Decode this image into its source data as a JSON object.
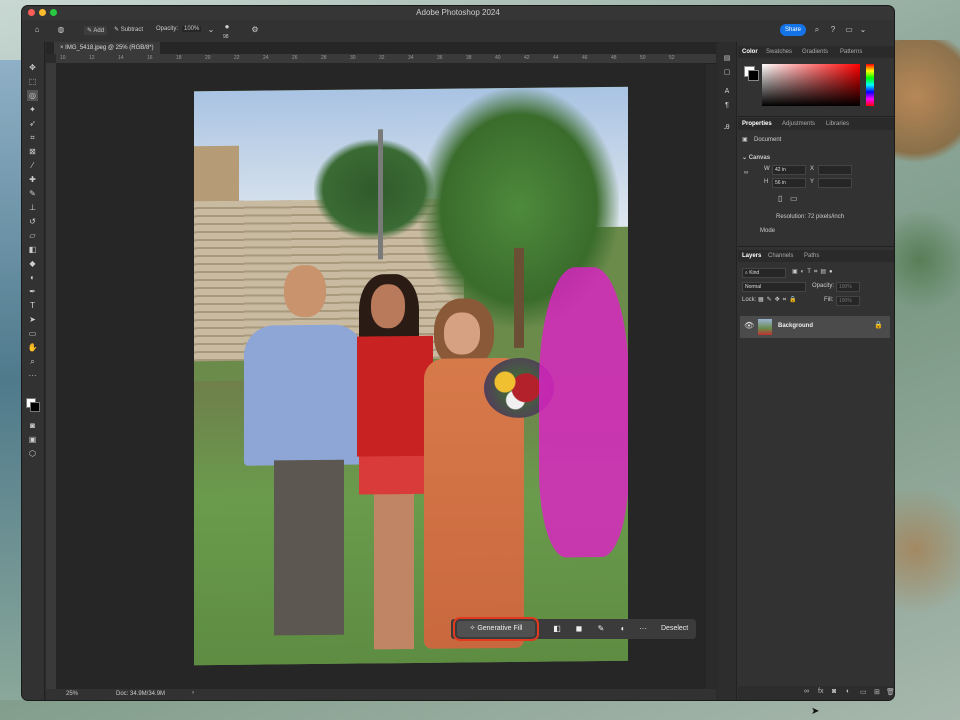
{
  "app": {
    "title": "Adobe Photoshop 2024",
    "share_label": "Share"
  },
  "options_bar": {
    "add_label": "Add",
    "subtract_label": "Subtract",
    "opacity_label": "Opacity:",
    "opacity_value": "100%",
    "brush_size": "98"
  },
  "document": {
    "tab_label": "IMG_5418.jpeg @ 25% (RGB/8*)"
  },
  "ruler": {
    "ticks": [
      "10",
      "12",
      "14",
      "16",
      "18",
      "20",
      "22",
      "24",
      "26",
      "28",
      "30",
      "32",
      "34",
      "36",
      "38",
      "40",
      "42",
      "44",
      "46",
      "48",
      "50",
      "52"
    ]
  },
  "context_bar": {
    "generative_fill": "Generative Fill",
    "deselect": "Deselect",
    "more": "···"
  },
  "status": {
    "zoom": "25%",
    "doc_size": "Doc: 34.9M/34.9M"
  },
  "color_panel": {
    "tabs": [
      "Color",
      "Swatches",
      "Gradients",
      "Patterns"
    ]
  },
  "properties_panel": {
    "tabs": [
      "Properties",
      "Adjustments",
      "Libraries"
    ],
    "document_label": "Document",
    "canvas_label": "Canvas",
    "w_label": "W",
    "w_value": "42 in",
    "h_label": "H",
    "h_value": "56 in",
    "x_label": "X",
    "y_label": "Y",
    "resolution": "Resolution: 72 pixels/inch",
    "mode_label": "Mode"
  },
  "layers_panel": {
    "tabs": [
      "Layers",
      "Channels",
      "Paths"
    ],
    "kind_label": "Kind",
    "blend_mode": "Normal",
    "opacity_label": "Opacity:",
    "opacity_value": "100%",
    "lock_label": "Lock:",
    "fill_label": "Fill:",
    "fill_value": "100%",
    "layer_name": "Background"
  },
  "colors": {
    "accent": "#1473e6",
    "highlight_box": "#e23a1e",
    "mask": "#e020c8"
  }
}
